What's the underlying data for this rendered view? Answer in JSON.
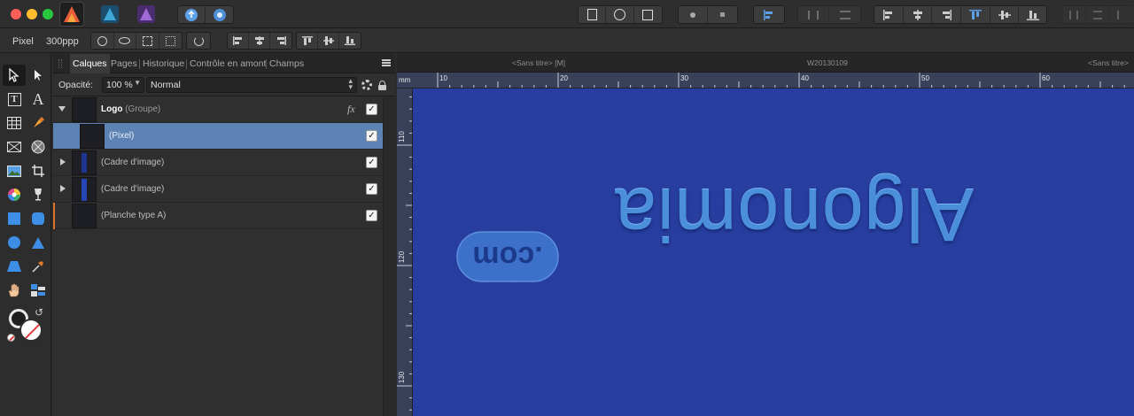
{
  "app": {
    "mode_apps": [
      "Affinity Photo",
      "Affinity Designer",
      "Affinity Publisher"
    ]
  },
  "context_toolbar": {
    "unit": "Pixel",
    "resolution": "300ppp"
  },
  "panel": {
    "tabs": [
      "Calques",
      "Pages",
      "Historique",
      "Contrôle en amont",
      "Champs"
    ],
    "active_tab": "Calques",
    "opacity_label": "Opacité:",
    "opacity_value": "100 %",
    "blend_mode": "Normal",
    "fx_label": "fx",
    "layers": [
      {
        "name": "Logo",
        "suffix": "(Groupe)",
        "visible": true,
        "expanded": true
      },
      {
        "name": "",
        "suffix": "(Pixel)",
        "visible": true,
        "selected": true
      },
      {
        "name": "",
        "suffix": "(Cadre d'image)",
        "visible": true
      },
      {
        "name": "",
        "suffix": "(Cadre d'image)",
        "visible": true
      },
      {
        "name": "",
        "suffix": "(Planche type A)",
        "visible": true
      }
    ]
  },
  "document": {
    "titles": [
      "<Sans titre> [M]",
      "W20130109",
      "<Sans titre>"
    ],
    "ruler_unit": "mm",
    "ruler_h_labels": [
      "10",
      "20",
      "30",
      "40",
      "50",
      "60"
    ],
    "ruler_v_labels": [
      "110",
      "120",
      "130"
    ],
    "canvas_text_main": "Algonomia",
    "canvas_text_badge": ".com",
    "canvas_color": "#22399e"
  }
}
